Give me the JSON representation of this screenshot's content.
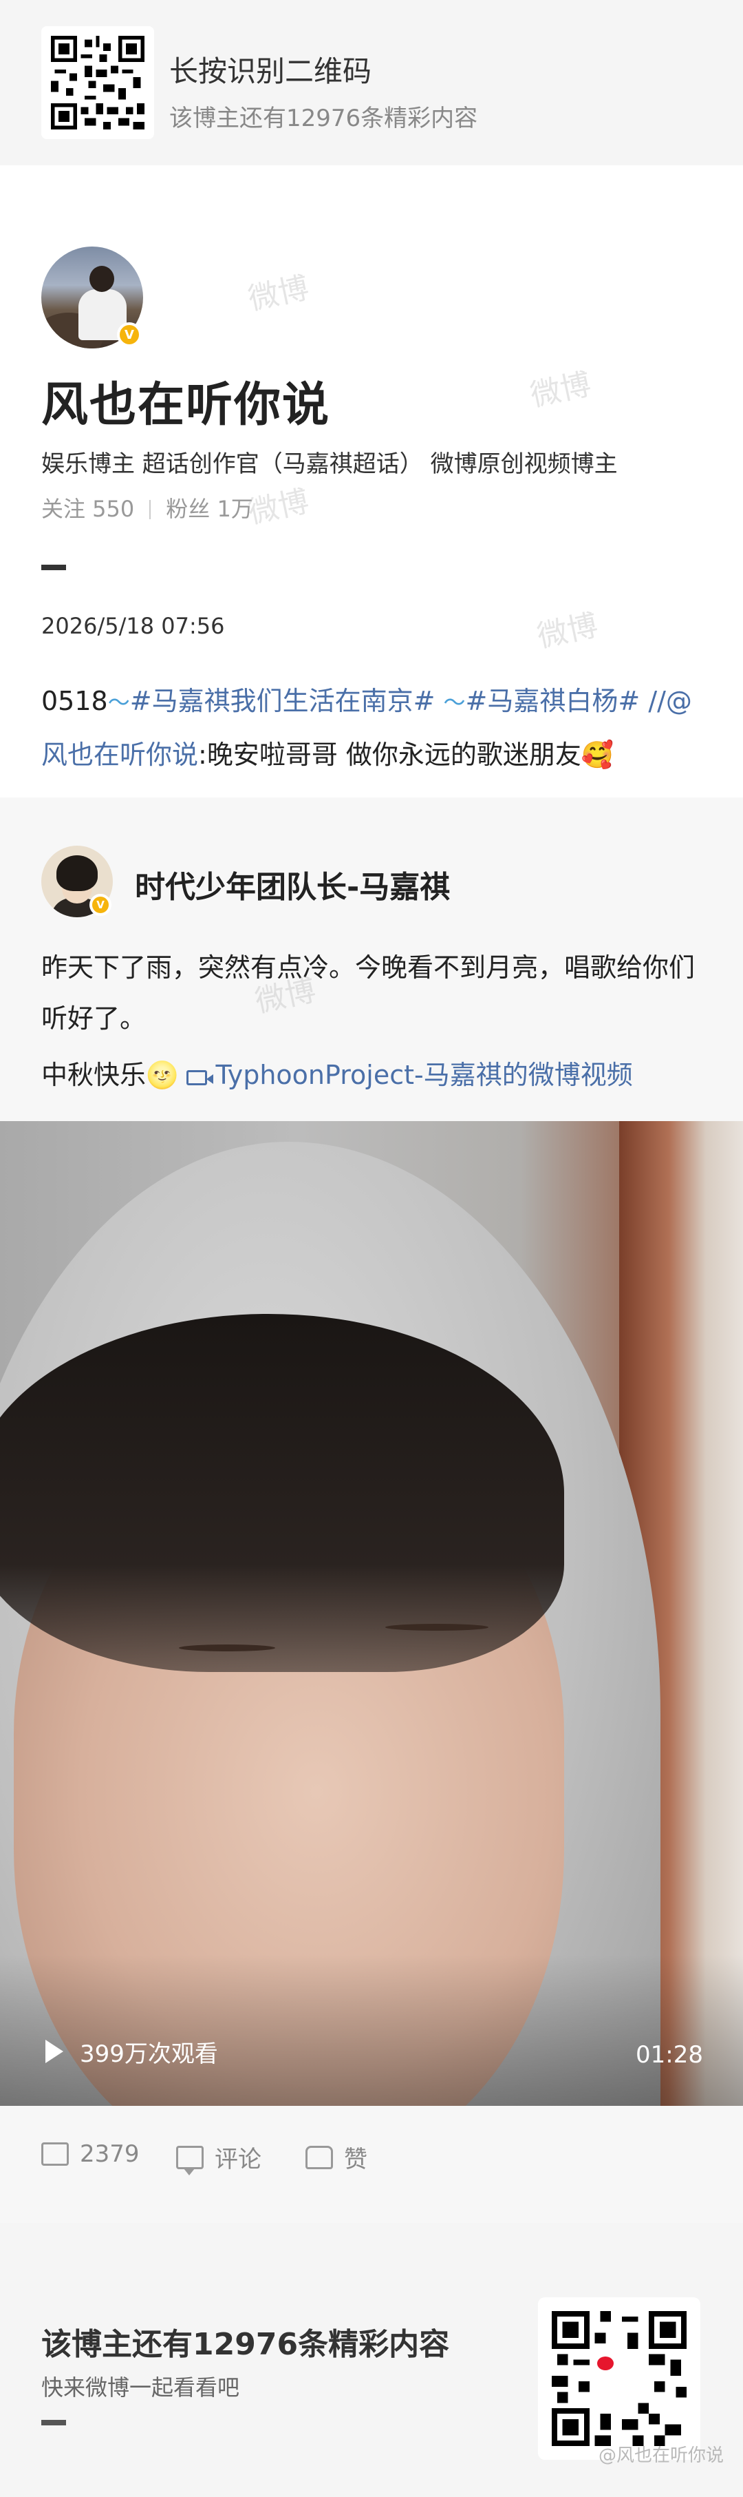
{
  "top_banner": {
    "title": "长按识别二维码",
    "subtitle": "该博主还有12976条精彩内容"
  },
  "profile": {
    "name": "风也在听你说",
    "tags": "娱乐博主 超话创作官（马嘉祺超话） 微博原创视频博主",
    "following_label": "关注 550",
    "followers_label": "粉丝 1万",
    "verified_badge": "V"
  },
  "post": {
    "time": "2026/5/18 07:56",
    "prefix": "0518",
    "hashtag1": "#马嘉祺我们生活在南京#",
    "hashtag2": "#马嘉祺白杨#",
    "repost_marker": "//@",
    "mention": "风也在听你说",
    "body": ":晚安啦哥哥 做你永远的歌迷朋友",
    "emoji_wave": "〜",
    "emoji_love": "🥰"
  },
  "repost": {
    "author": "时代少年团队长-马嘉祺",
    "text": "昨天下了雨，突然有点冷。今晚看不到月亮，唱歌给你们听好了。",
    "text2_prefix": "中秋快乐",
    "emoji_smile": "🌝",
    "video_link": "TyphoonProject-马嘉祺的微博视频",
    "video": {
      "views": "399万次观看",
      "duration": "01:28"
    }
  },
  "actions": {
    "repost_count": "2379",
    "comment_label": "评论",
    "like_label": "赞"
  },
  "bottom_banner": {
    "title": "该博主还有12976条精彩内容",
    "subtitle": "快来微博一起看看吧",
    "watermark": "@风也在听你说"
  },
  "watermark_text": "微博",
  "colors": {
    "link": "#4a6fa8",
    "verified": "#f6b40c",
    "banner_bg": "#f5f5f5",
    "weibo_red": "#e6162d"
  },
  "icons": [
    "qr-code-icon",
    "verified-icon",
    "wave-icon",
    "video-icon",
    "play-icon",
    "repost-icon",
    "comment-icon",
    "like-icon",
    "weibo-logo-icon"
  ]
}
